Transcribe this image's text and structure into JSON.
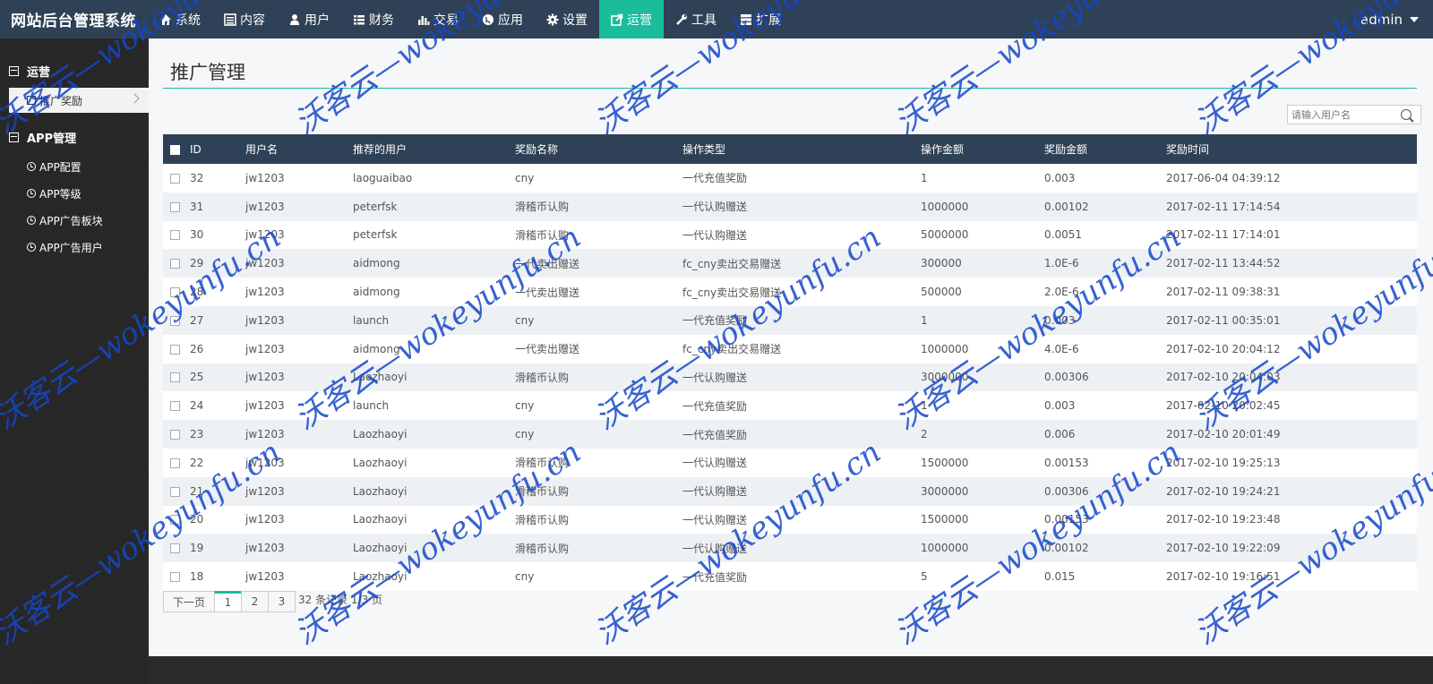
{
  "brand": "网站后台管理系统",
  "nav": [
    {
      "label": "系统",
      "icon": "home-icon"
    },
    {
      "label": "内容",
      "icon": "list-alt-icon"
    },
    {
      "label": "用户",
      "icon": "user-icon"
    },
    {
      "label": "财务",
      "icon": "list-icon"
    },
    {
      "label": "交易",
      "icon": "bar-chart-icon"
    },
    {
      "label": "应用",
      "icon": "globe-icon"
    },
    {
      "label": "设置",
      "icon": "gear-icon"
    },
    {
      "label": "运营",
      "icon": "share-icon",
      "active": true
    },
    {
      "label": "工具",
      "icon": "wrench-icon"
    },
    {
      "label": "扩展",
      "icon": "server-icon"
    }
  ],
  "user": {
    "name": "admin"
  },
  "sidebar": {
    "groups": [
      {
        "label": "运营",
        "items": [
          {
            "label": "推广奖励",
            "active": true
          }
        ]
      },
      {
        "label": "APP管理",
        "items": [
          {
            "label": "APP配置"
          },
          {
            "label": "APP等级"
          },
          {
            "label": "APP广告板块"
          },
          {
            "label": "APP广告用户"
          }
        ]
      }
    ]
  },
  "page": {
    "title": "推广管理"
  },
  "search": {
    "placeholder": "请输入用户名"
  },
  "table": {
    "columns": [
      "ID",
      "用户名",
      "推荐的用户",
      "奖励名称",
      "操作类型",
      "操作金额",
      "奖励金额",
      "奖励时间"
    ],
    "rows": [
      [
        "32",
        "jw1203",
        "laoguaibao",
        "cny",
        "一代充值奖励",
        "1",
        "0.003",
        "2017-06-04 04:39:12"
      ],
      [
        "31",
        "jw1203",
        "peterfsk",
        "滑稽币认购",
        "一代认购赠送",
        "1000000",
        "0.00102",
        "2017-02-11 17:14:54"
      ],
      [
        "30",
        "jw1203",
        "peterfsk",
        "滑稽币认购",
        "一代认购赠送",
        "5000000",
        "0.0051",
        "2017-02-11 17:14:01"
      ],
      [
        "29",
        "jw1203",
        "aidmong",
        "一代卖出赠送",
        "fc_cny卖出交易赠送",
        "300000",
        "1.0E-6",
        "2017-02-11 13:44:52"
      ],
      [
        "28",
        "jw1203",
        "aidmong",
        "一代卖出赠送",
        "fc_cny卖出交易赠送",
        "500000",
        "2.0E-6",
        "2017-02-11 09:38:31"
      ],
      [
        "27",
        "jw1203",
        "launch",
        "cny",
        "一代充值奖励",
        "1",
        "0.003",
        "2017-02-11 00:35:01"
      ],
      [
        "26",
        "jw1203",
        "aidmong",
        "一代卖出赠送",
        "fc_cny卖出交易赠送",
        "1000000",
        "4.0E-6",
        "2017-02-10 20:04:12"
      ],
      [
        "25",
        "jw1203",
        "Laozhaoyi",
        "滑稽币认购",
        "一代认购赠送",
        "3000000",
        "0.00306",
        "2017-02-10 20:04:03"
      ],
      [
        "24",
        "jw1203",
        "launch",
        "cny",
        "一代充值奖励",
        "1",
        "0.003",
        "2017-02-10 20:02:45"
      ],
      [
        "23",
        "jw1203",
        "Laozhaoyi",
        "cny",
        "一代充值奖励",
        "2",
        "0.006",
        "2017-02-10 20:01:49"
      ],
      [
        "22",
        "jw1203",
        "Laozhaoyi",
        "滑稽币认购",
        "一代认购赠送",
        "1500000",
        "0.00153",
        "2017-02-10 19:25:13"
      ],
      [
        "21",
        "jw1203",
        "Laozhaoyi",
        "滑稽币认购",
        "一代认购赠送",
        "3000000",
        "0.00306",
        "2017-02-10 19:24:21"
      ],
      [
        "20",
        "jw1203",
        "Laozhaoyi",
        "滑稽币认购",
        "一代认购赠送",
        "1500000",
        "0.00153",
        "2017-02-10 19:23:48"
      ],
      [
        "19",
        "jw1203",
        "Laozhaoyi",
        "滑稽币认购",
        "一代认购赠送",
        "1000000",
        "0.00102",
        "2017-02-10 19:22:09"
      ],
      [
        "18",
        "jw1203",
        "Laozhaoyi",
        "cny",
        "一代充值奖励",
        "5",
        "0.015",
        "2017-02-10 19:16:51"
      ]
    ]
  },
  "pager": {
    "prev": "下一页",
    "pages": [
      "1",
      "2",
      "3"
    ],
    "current": "1",
    "info": "32 条记录 1/3 页"
  },
  "watermark": "沃客云—wokeyunfu.cn",
  "colors": {
    "navbar": "#2f4156",
    "accent": "#1abc9c",
    "sidebar": "#262626"
  }
}
